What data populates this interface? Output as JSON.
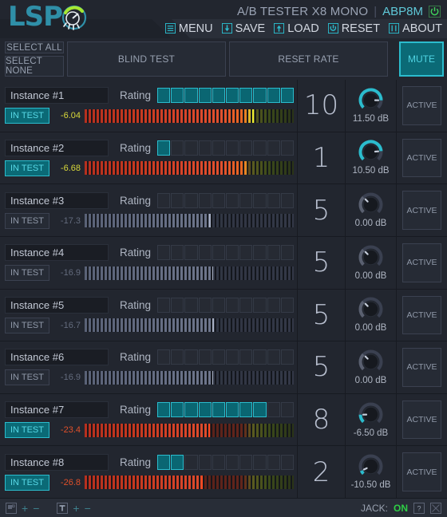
{
  "header": {
    "logo_text": "LSP",
    "plugin_title": "A/B TESTER X8 MONO",
    "separator": "|",
    "plugin_id": "ABP8M",
    "power_icon": "power-icon",
    "menu": [
      {
        "label": "MENU",
        "icon": "hamburger-icon"
      },
      {
        "label": "SAVE",
        "icon": "download-icon"
      },
      {
        "label": "LOAD",
        "icon": "upload-icon"
      },
      {
        "label": "RESET",
        "icon": "reset-icon"
      },
      {
        "label": "ABOUT",
        "icon": "info-icon"
      }
    ]
  },
  "toolbar": {
    "select_all": "SELECT ALL",
    "select_none": "SELECT NONE",
    "blind_test": "BLIND TEST",
    "reset_rate": "RESET RATE",
    "mute": "MUTE"
  },
  "labels": {
    "rating": "Rating",
    "in_test": "IN TEST",
    "active": "ACTIVE"
  },
  "colors": {
    "accent": "#2bbccd",
    "accent_fill": "#0b6a76",
    "panel": "#22262f",
    "text": "#c2c8d4",
    "jack_on": "#2ecf45"
  },
  "instances": [
    {
      "name": "Instance #1",
      "rating": 10,
      "rating_max": 10,
      "in_test": true,
      "level": "-6.04",
      "level_color": "#d8d83a",
      "meter_active": true,
      "meter_pct": 80.5,
      "peak_pct": 80.5,
      "number": "10",
      "gain": "11.50 dB",
      "gain_angle": 113,
      "knob_active": true,
      "active": "ACTIVE"
    },
    {
      "name": "Instance #2",
      "rating": 1,
      "rating_max": 10,
      "in_test": true,
      "level": "-6.68",
      "level_color": "#d8d83a",
      "meter_active": true,
      "meter_pct": 78.0,
      "peak_pct": 78.0,
      "number": "1",
      "gain": "10.50 dB",
      "gain_angle": 110,
      "knob_active": true,
      "active": "ACTIVE"
    },
    {
      "name": "Instance #3",
      "rating": 0,
      "rating_max": 10,
      "in_test": false,
      "level": "-17.3",
      "level_color": "#636b7d",
      "meter_active": false,
      "meter_pct": 60.0,
      "peak_pct": 60.0,
      "number": "5",
      "gain": "0.00 dB",
      "gain_angle": 45,
      "knob_active": false,
      "active": "ACTIVE"
    },
    {
      "name": "Instance #4",
      "rating": 0,
      "rating_max": 10,
      "in_test": false,
      "level": "-16.9",
      "level_color": "#636b7d",
      "meter_active": false,
      "meter_pct": 61.0,
      "peak_pct": 61.0,
      "number": "5",
      "gain": "0.00 dB",
      "gain_angle": 45,
      "knob_active": false,
      "active": "ACTIVE"
    },
    {
      "name": "Instance #5",
      "rating": 0,
      "rating_max": 10,
      "in_test": false,
      "level": "-16.7",
      "level_color": "#636b7d",
      "meter_active": false,
      "meter_pct": 61.5,
      "peak_pct": 61.5,
      "number": "5",
      "gain": "0.00 dB",
      "gain_angle": 45,
      "knob_active": false,
      "active": "ACTIVE"
    },
    {
      "name": "Instance #6",
      "rating": 0,
      "rating_max": 10,
      "in_test": false,
      "level": "-16.9",
      "level_color": "#636b7d",
      "meter_active": false,
      "meter_pct": 61.0,
      "peak_pct": 61.0,
      "number": "5",
      "gain": "0.00 dB",
      "gain_angle": 45,
      "knob_active": false,
      "active": "ACTIVE"
    },
    {
      "name": "Instance #7",
      "rating": 8,
      "rating_max": 10,
      "in_test": true,
      "level": "-23.4",
      "level_color": "#e0502a",
      "meter_active": true,
      "meter_pct": 59.5,
      "peak_pct": 59.5,
      "number": "8",
      "gain": "-6.50 dB",
      "gain_angle": 22,
      "knob_active": true,
      "active": "ACTIVE"
    },
    {
      "name": "Instance #8",
      "rating": 2,
      "rating_max": 10,
      "in_test": true,
      "level": "-26.8",
      "level_color": "#e0502a",
      "meter_active": true,
      "meter_pct": 56.0,
      "peak_pct": 56.0,
      "number": "2",
      "gain": "-10.50 dB",
      "gain_angle": 10,
      "knob_active": true,
      "active": "ACTIVE"
    }
  ],
  "statusbar": {
    "left_icons": [
      {
        "icon": "ui-scale-icon",
        "plus": "+",
        "minus": "−"
      },
      {
        "icon": "font-scale-icon",
        "plus": "+",
        "minus": "−"
      }
    ],
    "jack_label": "JACK:",
    "jack_state": "ON",
    "help_icon": "help-icon",
    "fullscreen_icon": "fullscreen-icon"
  }
}
